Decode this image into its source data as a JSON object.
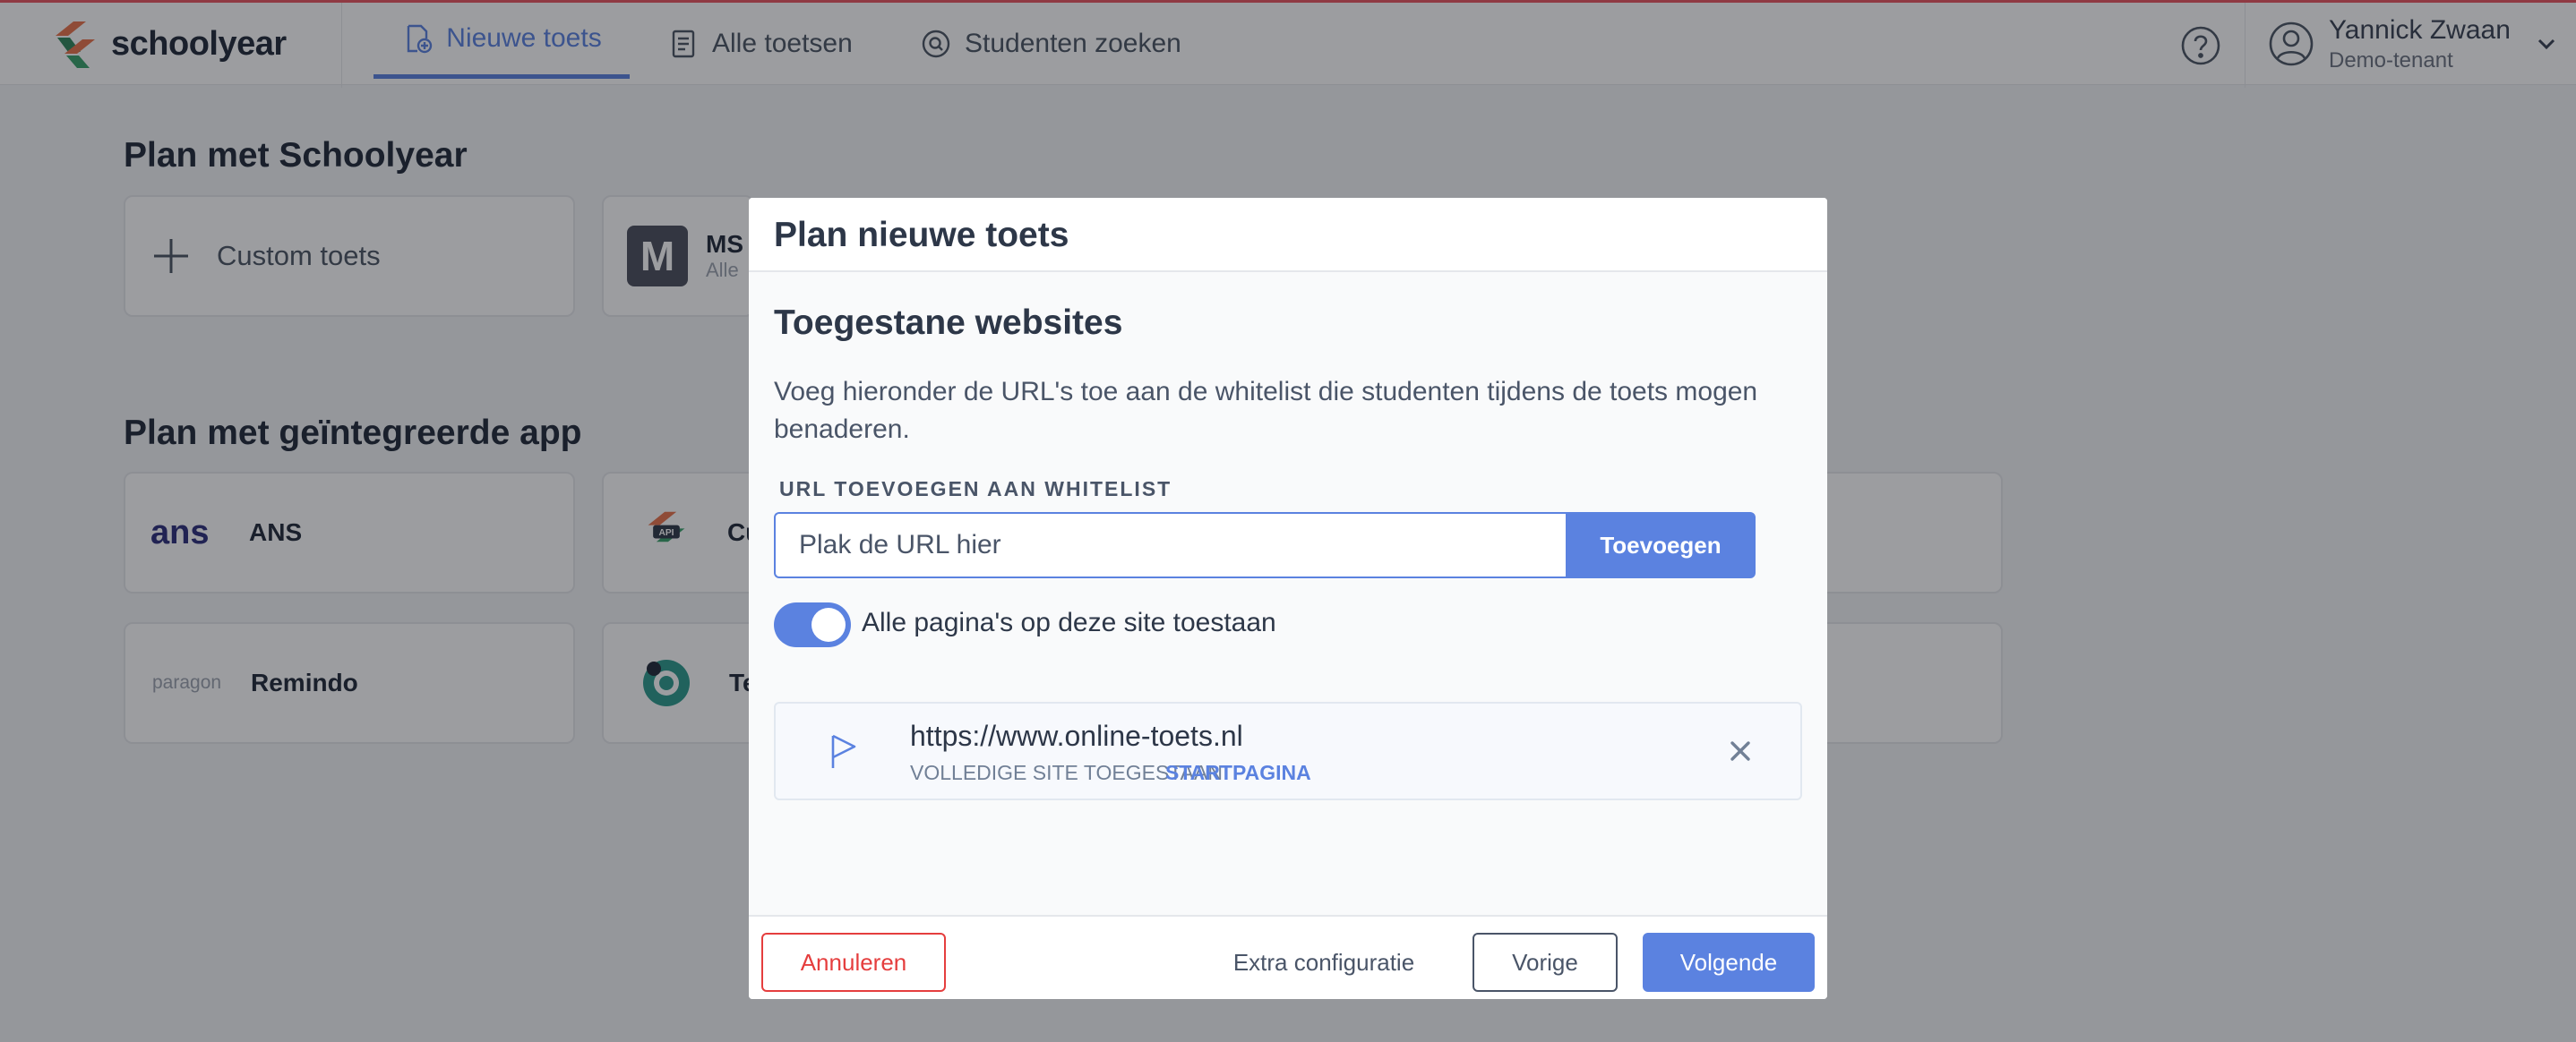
{
  "app": {
    "logo_text": "schoolyear"
  },
  "nav": {
    "tabs": [
      {
        "label": "Nieuwe toets",
        "icon": "new-test-icon",
        "active": true
      },
      {
        "label": "Alle toetsen",
        "icon": "document-list-icon",
        "active": false
      },
      {
        "label": "Studenten zoeken",
        "icon": "search-icon",
        "active": false
      }
    ]
  },
  "user": {
    "name": "Yannick Zwaan",
    "tenant": "Demo-tenant"
  },
  "background": {
    "section1_title": "Plan met Schoolyear",
    "custom_card_label": "Custom toets",
    "ms_card_letter": "M",
    "ms_card_label": "MS",
    "ms_card_sub": "Alle",
    "section2_title": "Plan met geïntegreerde app",
    "ans_logo": "ans",
    "ans_label": "ANS",
    "api_label": "Cu",
    "remindo_logo": "paragon",
    "remindo_label": "Remindo",
    "te_label": "Te"
  },
  "modal": {
    "title": "Plan nieuwe toets",
    "section_title": "Toegestane websites",
    "description": "Voeg hieronder de URL's toe aan de whitelist die studenten tijdens de toets mogen benaderen.",
    "field_label": "URL TOEVOEGEN AAN WHITELIST",
    "input_placeholder": "Plak de URL hier",
    "input_value": "",
    "add_button": "Toevoegen",
    "toggle_label": "Alle pagina's op deze site toestaan",
    "toggle_on": true,
    "whitelist": [
      {
        "url": "https://www.online-toets.nl",
        "scope": "VOLLEDIGE SITE TOEGESTAAN",
        "tag": "STARTPAGINA"
      }
    ],
    "footer": {
      "cancel": "Annuleren",
      "extra": "Extra configuratie",
      "previous": "Vorige",
      "next": "Volgende"
    }
  },
  "colors": {
    "accent": "#5b82e0",
    "danger": "#e53e3e",
    "top_border": "#e8555f"
  }
}
